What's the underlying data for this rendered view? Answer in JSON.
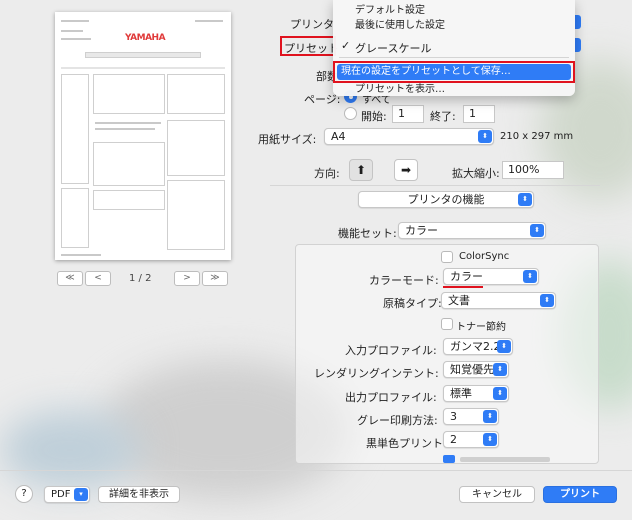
{
  "preview": {
    "logo_text": "YAMAHA",
    "page_indicator": "1 / 2",
    "first_btn": "≪",
    "prev_btn": "<",
    "next_btn": ">",
    "last_btn": "≫"
  },
  "labels": {
    "printer": "プリンタ",
    "preset": "プリセット",
    "copies": "部数",
    "pages": "ページ:",
    "paper_size": "用紙サイズ:",
    "orientation": "方向:",
    "scale": "拡大縮小:"
  },
  "dropdown_menu": {
    "items": [
      "デフォルト設定",
      "最後に使用した設定",
      "グレースケール",
      "現在の設定をプリセットとして保存…",
      "プリセットを表示…"
    ],
    "checked_item": "✓"
  },
  "pages": {
    "all_label": "すべて",
    "range_label": "開始:",
    "from_value": "1",
    "to_label": "終了:",
    "to_value": "1"
  },
  "paper": {
    "size": "A4",
    "dimensions": "210 x 297 mm"
  },
  "scale": {
    "value": "100%"
  },
  "section_popup": "プリンタの機能",
  "feature_set": {
    "label": "機能セット:",
    "value": "カラー"
  },
  "panel": {
    "colorsync_label": "ColorSync",
    "color_mode": {
      "label": "カラーモード:",
      "value": "カラー"
    },
    "original_type": {
      "label": "原稿タイプ:",
      "value": "文書"
    },
    "toner_save_label": "トナー節約",
    "input_profile": {
      "label": "入力プロファイル:",
      "value": "ガンマ2.2"
    },
    "rendering_intent": {
      "label": "レンダリングインテント:",
      "value": "知覚優先"
    },
    "output_profile": {
      "label": "出力プロファイル:",
      "value": "標準"
    },
    "gray_method": {
      "label": "グレー印刷方法:",
      "value": "3"
    },
    "black_print": {
      "label": "黒単色プリント:",
      "value": "2"
    }
  },
  "bottom": {
    "help": "?",
    "pdf": "PDF",
    "hide_details": "詳細を非表示",
    "cancel": "キャンセル",
    "print": "プリント"
  },
  "colors": {
    "accent": "#2f7cf6",
    "annotation_red": "#e0121e"
  }
}
